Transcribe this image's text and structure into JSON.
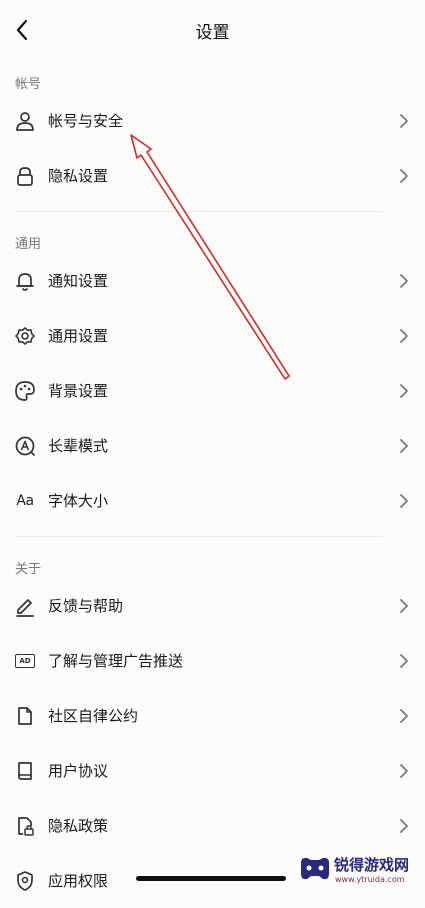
{
  "header": {
    "title": "设置",
    "back_icon": "chevron-left-icon"
  },
  "sections": {
    "account": {
      "label": "帐号",
      "items": [
        {
          "label": "帐号与安全",
          "icon": "user-icon"
        },
        {
          "label": "隐私设置",
          "icon": "lock-icon"
        }
      ]
    },
    "general": {
      "label": "通用",
      "items": [
        {
          "label": "通知设置",
          "icon": "bell-icon"
        },
        {
          "label": "通用设置",
          "icon": "gear-icon"
        },
        {
          "label": "背景设置",
          "icon": "palette-icon"
        },
        {
          "label": "长辈模式",
          "icon": "elder-mode-icon"
        },
        {
          "label": "字体大小",
          "icon": "font-size-icon",
          "glyph": "Aa"
        }
      ]
    },
    "about": {
      "label": "关于",
      "items": [
        {
          "label": "反馈与帮助",
          "icon": "pen-icon"
        },
        {
          "label": "了解与管理广告推送",
          "icon": "ad-icon",
          "glyph": "AD"
        },
        {
          "label": "社区自律公约",
          "icon": "document-icon"
        },
        {
          "label": "用户协议",
          "icon": "book-icon"
        },
        {
          "label": "隐私政策",
          "icon": "privacy-document-icon"
        },
        {
          "label": "应用权限",
          "icon": "shield-icon"
        }
      ]
    }
  },
  "watermark": {
    "title": "锐得游戏网",
    "url": "www.ytruida.com"
  },
  "colors": {
    "annotation_arrow": "#d62b2b",
    "background": "#fcfcfa",
    "text": "#1a1a1a",
    "section_label": "#777777"
  }
}
